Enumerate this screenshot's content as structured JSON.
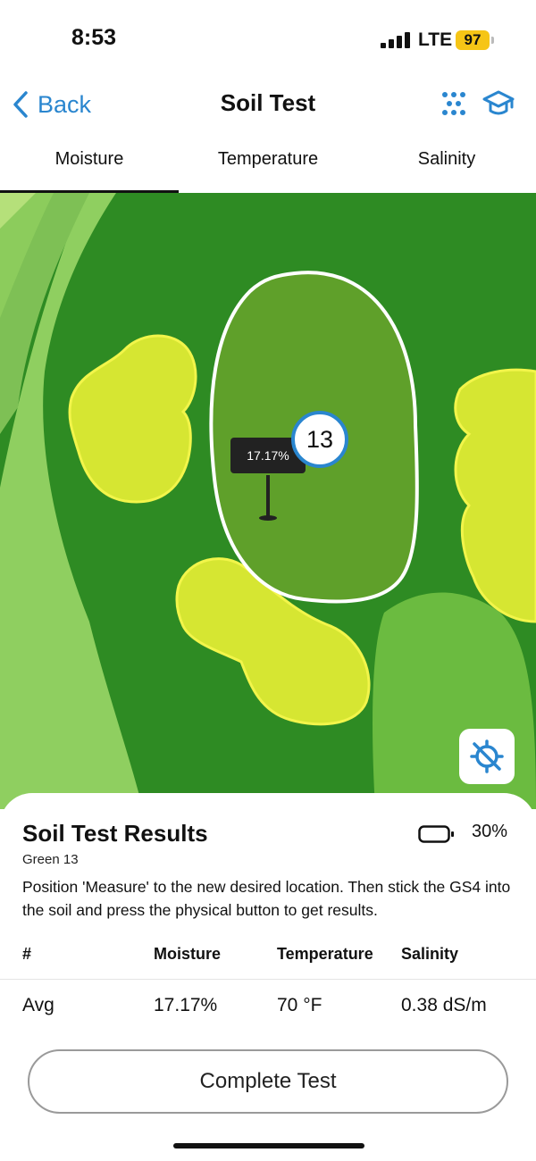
{
  "status_bar": {
    "time": "8:53",
    "network": "LTE",
    "battery": "97"
  },
  "nav": {
    "back_label": "Back",
    "title": "Soil Test",
    "icons": [
      "dots-grid-icon",
      "graduation-cap-icon"
    ]
  },
  "tabs": [
    {
      "label": "Moisture",
      "active": true
    },
    {
      "label": "Temperature",
      "active": false
    },
    {
      "label": "Salinity",
      "active": false
    }
  ],
  "map": {
    "pin_value": "17.17%",
    "hole_number": "13",
    "recenter_icon": "location-crosshair-icon"
  },
  "results": {
    "title": "Soil Test Results",
    "device_battery": "30%",
    "green": "Green 13",
    "instruction": "Position 'Measure' to the new desired location. Then stick the GS4 into the soil and press the physical button to get results.",
    "headers": [
      "#",
      "Moisture",
      "Temperature",
      "Salinity"
    ],
    "rows": [
      {
        "label": "Avg",
        "moisture": "17.17%",
        "temperature": "70 °F",
        "salinity": "0.38 dS/m"
      }
    ]
  },
  "actions": {
    "complete_label": "Complete Test"
  },
  "colors": {
    "accent": "#2a86cf",
    "fairway": "#2e8b23",
    "green": "#5fa02a",
    "bunker": "#d6e632",
    "rough": "#8ccc5c",
    "badge": "#f6c516"
  }
}
